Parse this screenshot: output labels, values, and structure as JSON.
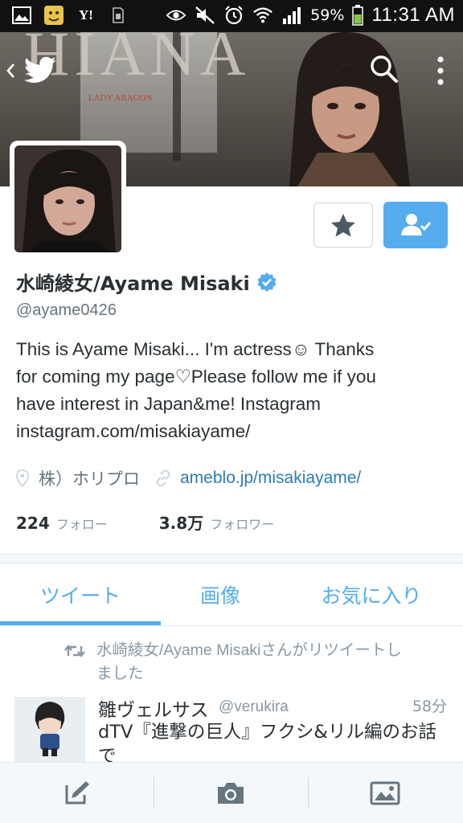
{
  "status_bar": {
    "icons": [
      "gallery-icon",
      "app-notification-icon",
      "yahoo-icon",
      "sim-icon",
      "eye-icon",
      "mute-icon",
      "alarm-icon",
      "wifi-icon",
      "signal-icon",
      "battery-icon"
    ],
    "yahoo_label": "Y!",
    "battery": "59%",
    "time": "11:31 AM"
  },
  "banner": {
    "title_text": "HIANA",
    "subtitle_text": "LADY ARAGON",
    "nav_icons": [
      "back-icon",
      "twitter-bird-icon",
      "search-icon",
      "more-icon"
    ]
  },
  "profile": {
    "display_name": "水崎綾女/Ayame Misaki",
    "verified": true,
    "handle": "@ayame0426",
    "bio_lines": [
      "This is Ayame Misaki... I'm actress☺ Thanks",
      "for coming my page♡Please follow me if you",
      "have interest in Japan&me! Instagram",
      "instagram.com/misakiayame/"
    ],
    "location": "株）ホリプロ",
    "url": "ameblo.jp/misakiayame/",
    "following_count": "224",
    "following_label": "フォロー",
    "followers_count": "3.8万",
    "followers_label": "フォロワー"
  },
  "actions": {
    "favorite_icon": "star-icon",
    "follow_icon": "following-check-icon"
  },
  "tabs": [
    {
      "label": "ツイート",
      "active": true
    },
    {
      "label": "画像",
      "active": false
    },
    {
      "label": "お気に入り",
      "active": false
    }
  ],
  "tweet": {
    "retweet_line1": "水崎綾女/Ayame Misakiさんがリツイートし",
    "retweet_line2": "ました",
    "author": "雛ヴェルサス",
    "handle": "@verukira",
    "time": "58分",
    "text": "dTV『進撃の巨人』フクシ&リル編のお話で"
  },
  "bottom_bar": {
    "icons": [
      "compose-icon",
      "camera-icon",
      "image-icon"
    ]
  },
  "colors": {
    "accent": "#55acee",
    "link": "#2b7bb9",
    "muted": "#8899a6",
    "text": "#292f33"
  }
}
